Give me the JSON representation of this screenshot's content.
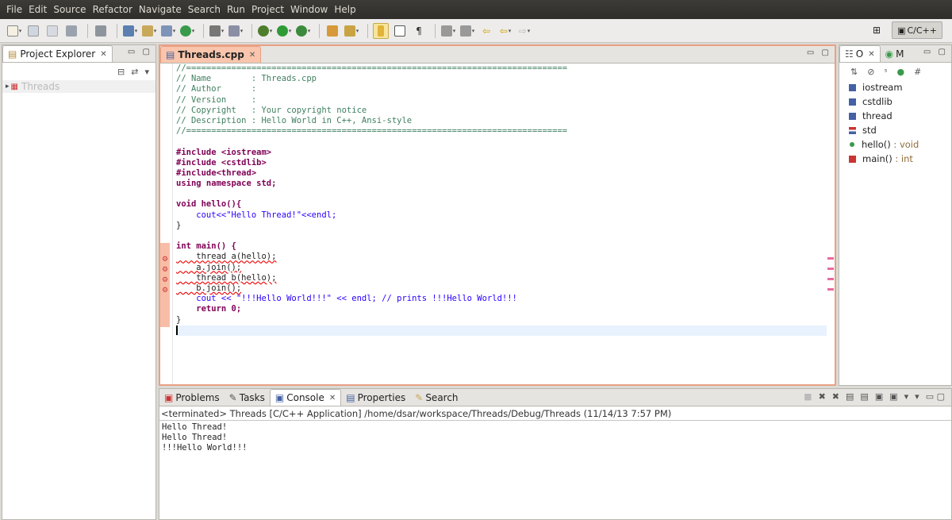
{
  "menu": [
    "File",
    "Edit",
    "Source",
    "Refactor",
    "Navigate",
    "Search",
    "Run",
    "Project",
    "Window",
    "Help"
  ],
  "perspective": {
    "label": "C/C++"
  },
  "project_explorer": {
    "title": "Project Explorer",
    "tree": [
      {
        "label": "Threads"
      }
    ]
  },
  "editor": {
    "tab": "Threads.cpp",
    "lines": [
      "//============================================================================",
      "// Name        : Threads.cpp",
      "// Author      :",
      "// Version     :",
      "// Copyright   : Your copyright notice",
      "// Description : Hello World in C++, Ansi-style",
      "//============================================================================",
      "",
      "#include <iostream>",
      "#include <cstdlib>",
      "#include<thread>",
      "using namespace std;",
      "",
      "void hello(){",
      "    cout<<\"Hello Thread!\"<<endl;",
      "}",
      "",
      "int main() {",
      "    thread a(hello);",
      "    a.join();",
      "    thread b(hello);",
      "    b.join();",
      "    cout << \"!!!Hello World!!!\" << endl; // prints !!!Hello World!!!",
      "    return 0;",
      "}",
      ""
    ]
  },
  "outline": {
    "tabs": [
      {
        "label": "O"
      },
      {
        "label": "M"
      }
    ],
    "items": [
      {
        "label": "iostream",
        "icon": "include-icon"
      },
      {
        "label": "cstdlib",
        "icon": "include-icon"
      },
      {
        "label": "thread",
        "icon": "include-icon"
      },
      {
        "label": "std",
        "icon": "namespace-icon"
      },
      {
        "label": "hello()",
        "sig": " : void",
        "icon": "function-icon"
      },
      {
        "label": "main()",
        "sig": " : int",
        "icon": "function-error-icon"
      }
    ]
  },
  "bottom_tabs": [
    "Problems",
    "Tasks",
    "Console",
    "Properties",
    "Search"
  ],
  "console": {
    "status": "<terminated> Threads [C/C++ Application] /home/dsar/workspace/Threads/Debug/Threads (11/14/13 7:57 PM)",
    "output": [
      "Hello Thread!",
      "Hello Thread!",
      "!!!Hello World!!!"
    ]
  },
  "colors": {
    "editor_border": "#e8a085",
    "error_marker": "#e96aa0",
    "active_tab": "#f9c5ac"
  }
}
